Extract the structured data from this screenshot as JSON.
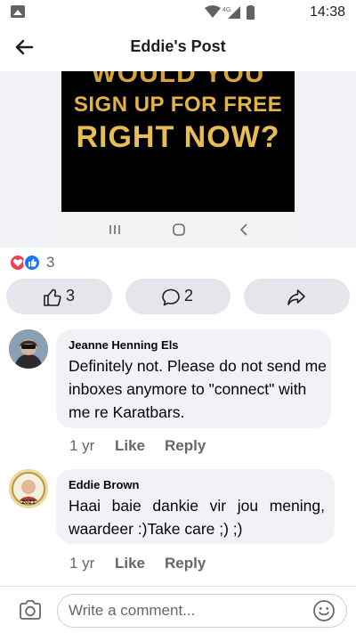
{
  "status_bar": {
    "time": "14:38",
    "network": "4G"
  },
  "header": {
    "title": "Eddie's Post",
    "back_icon": "arrow-left-icon"
  },
  "post_image": {
    "line1": "WOULD YOU",
    "line2": "SIGN UP FOR FREE",
    "line3": "RIGHT NOW?"
  },
  "reactions": {
    "total": "3",
    "types": [
      "love",
      "like"
    ]
  },
  "actions": {
    "like_count": "3",
    "comment_count": "2"
  },
  "comments": [
    {
      "author": "Jeanne Henning Els",
      "text": "Definitely not. Please do not send me inboxes anymore to \"connect\" with me re Karatbars.",
      "age": "1 yr",
      "like_label": "Like",
      "reply_label": "Reply"
    },
    {
      "author": "Eddie Brown",
      "text": "Haai baie dankie vir jou mening, waardeer :)Take care ;) ;)",
      "age": "1 yr",
      "like_label": "Like",
      "reply_label": "Reply",
      "avatar_badge": "2021"
    }
  ],
  "composer": {
    "placeholder": "Write a comment..."
  },
  "colors": {
    "accent": "#1877f2",
    "love": "#f33e58",
    "bubble": "#f0f2f5",
    "button": "#e4e6eb",
    "muted": "#65676b"
  }
}
